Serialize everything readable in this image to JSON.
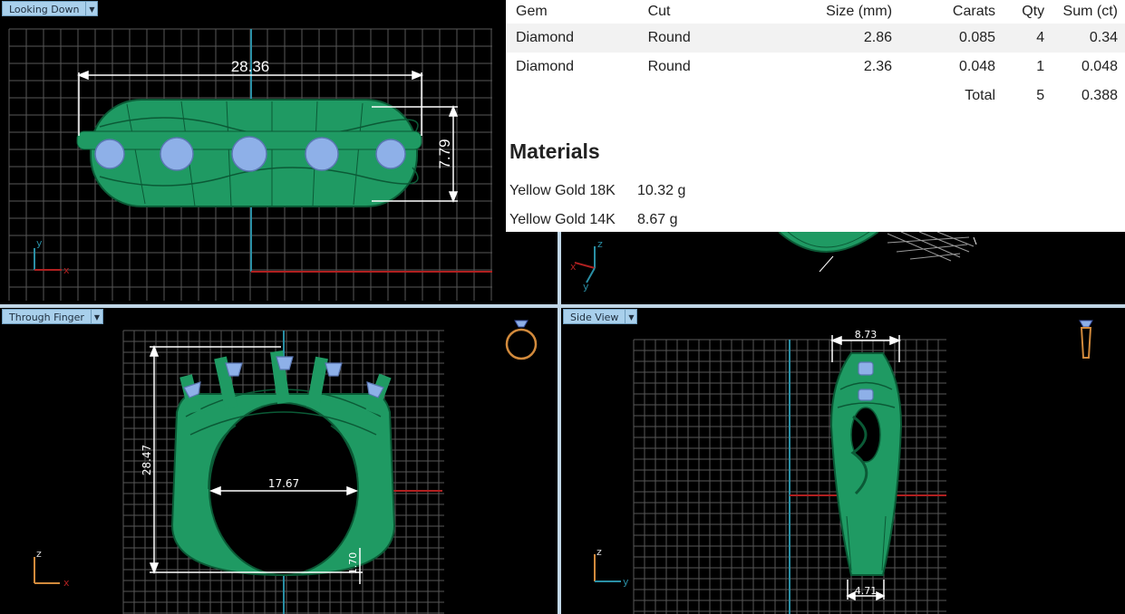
{
  "viewports": {
    "top_left": {
      "label": "Looking Down",
      "dims": {
        "length": "28.36",
        "height": "7.79"
      },
      "axes": {
        "v": "y",
        "h": "x"
      }
    },
    "top_right": {
      "axes": {
        "v": "z",
        "h": "x",
        "d": "y"
      }
    },
    "bottom_left": {
      "label": "Through Finger",
      "dims": {
        "height": "28.47",
        "inner": "17.67",
        "band": "1.70"
      },
      "axes": {
        "v": "z",
        "h": "x"
      }
    },
    "bottom_right": {
      "label": "Side View",
      "dims": {
        "top": "8.73",
        "bottom": "4.71"
      },
      "axes": {
        "v": "z",
        "h": "y"
      }
    }
  },
  "gems_table": {
    "headers": [
      "Gem",
      "Cut",
      "Size (mm)",
      "Carats",
      "Qty",
      "Sum (ct)"
    ],
    "rows": [
      [
        "Diamond",
        "Round",
        "2.86",
        "0.085",
        "4",
        "0.34"
      ],
      [
        "Diamond",
        "Round",
        "2.36",
        "0.048",
        "1",
        "0.048"
      ]
    ],
    "total_label": "Total",
    "total_qty": "5",
    "total_sum": "0.388"
  },
  "materials": {
    "title": "Materials",
    "items": [
      {
        "name": "Yellow Gold 18K",
        "weight": "10.32 g"
      },
      {
        "name": "Yellow Gold 14K",
        "weight": "8.67 g"
      }
    ]
  },
  "colors": {
    "ring": "#1f9a63",
    "wire": "#0b5a36",
    "gem": "#8eb0e8",
    "grid": "#5a5a5a",
    "accent_tab": "#a9d0ec",
    "axis_teal": "#2a8fa5",
    "axis_red": "#b02020"
  }
}
